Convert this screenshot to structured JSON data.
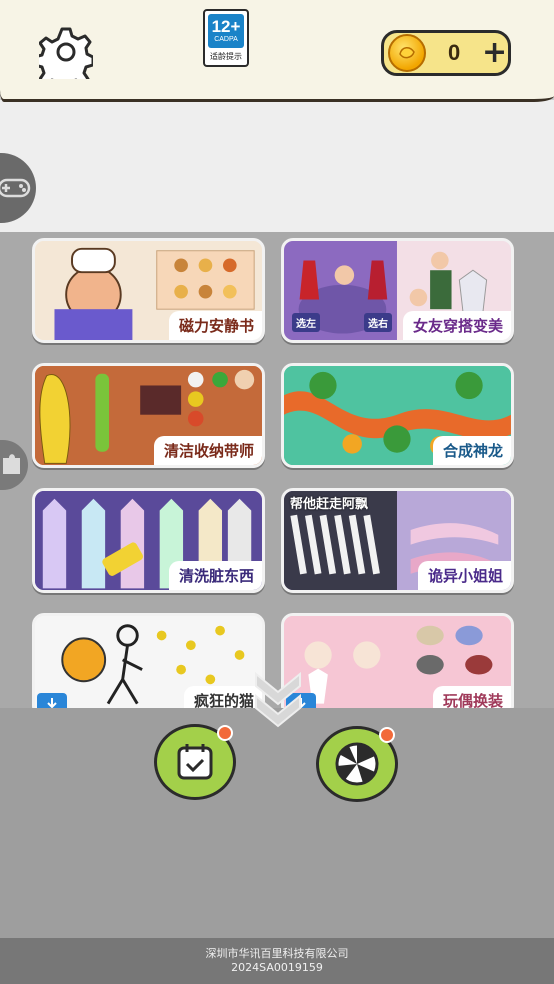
{
  "header": {
    "age_rating": {
      "number": "12+",
      "org": "CADPA",
      "tip": "适龄提示"
    },
    "coins": {
      "value": "0",
      "add_label": "+"
    }
  },
  "games": [
    {
      "title": "磁力安静书",
      "bg": "#f4e7d6",
      "accent": "#b8412d"
    },
    {
      "title": "女友穿搭变美",
      "bg": "#efe0ea",
      "accent": "#6a4aa0",
      "tags": [
        "选左",
        "选右"
      ]
    },
    {
      "title": "清洁收纳带师",
      "bg": "#c46a3a",
      "accent": "#f2d233"
    },
    {
      "title": "合成神龙",
      "bg": "#4fc3a0",
      "accent": "#e86a2a"
    },
    {
      "title": "清洗脏东西",
      "bg": "#7a5cb8",
      "accent": "#e8e0f4"
    },
    {
      "title": "诡异小姐姐",
      "bg": "#6e5aa8",
      "accent": "#f0c8e0",
      "banner": "帮他赶走阿飘"
    },
    {
      "title": "疯狂的猫",
      "bg": "#f4f4f4",
      "accent": "#f2a623"
    },
    {
      "title": "玩偶换装",
      "bg": "#f6c6d4",
      "accent": "#d86a8a"
    }
  ],
  "footer": {
    "company": "深圳市华讯百里科技有限公司",
    "license": "2024SA0019159"
  },
  "colors": {
    "topbar": "#f7f4e6",
    "coin_box": "#f6e48a",
    "round_btn": "#a3d04a",
    "notify_dot": "#f26a3a"
  }
}
